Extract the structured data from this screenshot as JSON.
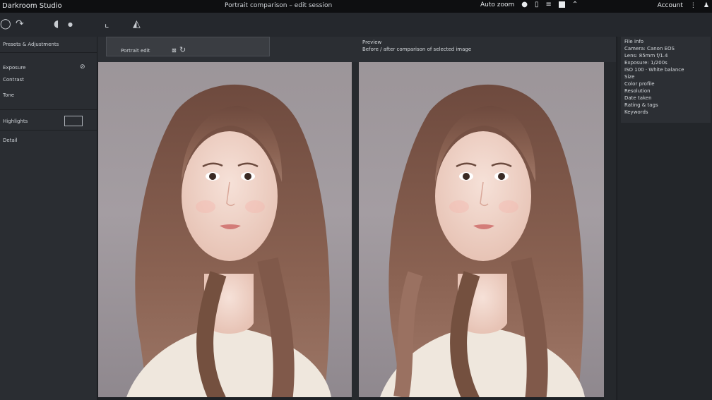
{
  "titlebar": {
    "app_name": "Darkroom Studio",
    "document": "Portrait comparison – edit session",
    "zoom_label": "Auto zoom",
    "right_label": "Account"
  },
  "toolbar": {
    "icons": [
      "open-icon",
      "redo-icon",
      "tag-icon",
      "dot-icon",
      "crop-icon",
      "pen-icon"
    ]
  },
  "left_panel": {
    "header": "Presets & Adjustments",
    "items": [
      "Exposure",
      "Contrast",
      "Tone",
      "Highlights",
      "Detail"
    ]
  },
  "tab": {
    "label": "Portrait edit"
  },
  "right_header": {
    "line1": "Preview",
    "line2": "Before / after comparison of selected image"
  },
  "properties": {
    "items": [
      "File info",
      "Camera: Canon EOS",
      "Lens: 85mm f/1.4",
      "Exposure: 1/200s",
      "ISO 100 · White balance",
      "Size",
      "Color profile",
      "Resolution",
      "Date taken",
      "Rating & tags",
      "Keywords"
    ]
  },
  "colors": {
    "background": "#1f2226",
    "panel": "#2a2d32",
    "canvas": "#9c9599",
    "hair": "#7a5446",
    "skin": "#f0d7cc"
  }
}
